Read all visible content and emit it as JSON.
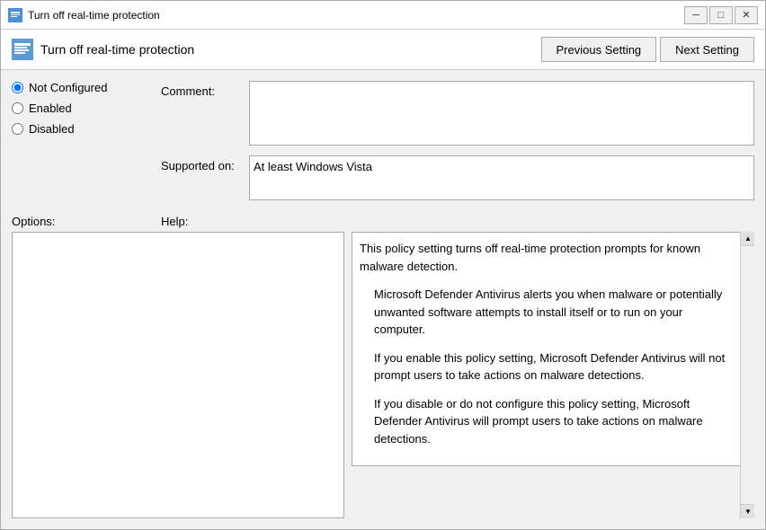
{
  "window": {
    "title": "Turn off real-time protection",
    "minimize_label": "─",
    "maximize_label": "□",
    "close_label": "✕"
  },
  "header": {
    "icon_label": "GP",
    "title": "Turn off real-time protection",
    "prev_button": "Previous Setting",
    "next_button": "Next Setting"
  },
  "radio_group": {
    "not_configured_label": "Not Configured",
    "enabled_label": "Enabled",
    "disabled_label": "Disabled",
    "selected": "not_configured"
  },
  "fields": {
    "comment_label": "Comment:",
    "supported_label": "Supported on:",
    "supported_value": "At least Windows Vista"
  },
  "sections": {
    "options_label": "Options:",
    "help_label": "Help:"
  },
  "help_text": {
    "paragraph1": "This policy setting turns off real-time protection prompts for known malware detection.",
    "paragraph2": "Microsoft Defender Antivirus alerts you when malware or potentially unwanted software attempts to install itself or to run on your computer.",
    "paragraph3": "If you enable this policy setting, Microsoft Defender Antivirus will not prompt users to take actions on malware detections.",
    "paragraph4": "If you disable or do not configure this policy setting, Microsoft Defender Antivirus will prompt users to take actions on malware detections."
  }
}
